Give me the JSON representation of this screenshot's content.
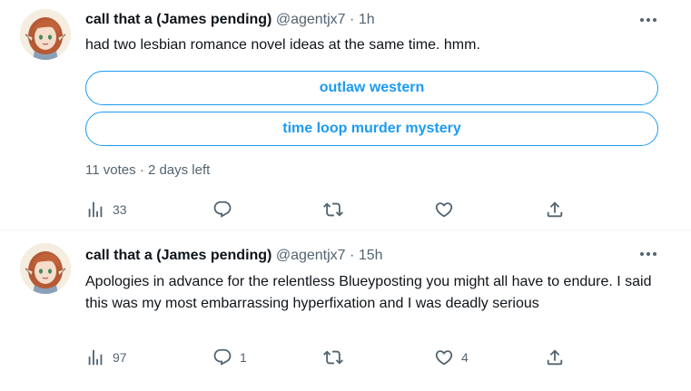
{
  "tweets": [
    {
      "author_name": "call that a (James pending)",
      "handle": "@agentjx7",
      "separator": "·",
      "time": "1h",
      "text": "had two lesbian romance novel ideas at the same time. hmm.",
      "poll": {
        "options": [
          "outlaw western",
          "time loop murder mystery"
        ],
        "votes": "11 votes",
        "time_left": "2 days left",
        "meta_separator": "·"
      },
      "stats": {
        "views": "33",
        "replies": "",
        "retweets": "",
        "likes": ""
      }
    },
    {
      "author_name": "call that a (James pending)",
      "handle": "@agentjx7",
      "separator": "·",
      "time": "15h",
      "text": "Apologies in advance for the relentless Blueyposting you might all have to endure. I said this was my most embarrassing hyperfixation and I was deadly serious",
      "stats": {
        "views": "97",
        "replies": "1",
        "retweets": "",
        "likes": "4"
      }
    }
  ],
  "colors": {
    "accent": "#1d9bf0",
    "text_primary": "#0f1419",
    "text_secondary": "#536471",
    "divider": "#eff3f4"
  },
  "icons": [
    "more-dots-icon",
    "analytics-icon",
    "reply-icon",
    "retweet-icon",
    "like-icon",
    "share-icon"
  ]
}
